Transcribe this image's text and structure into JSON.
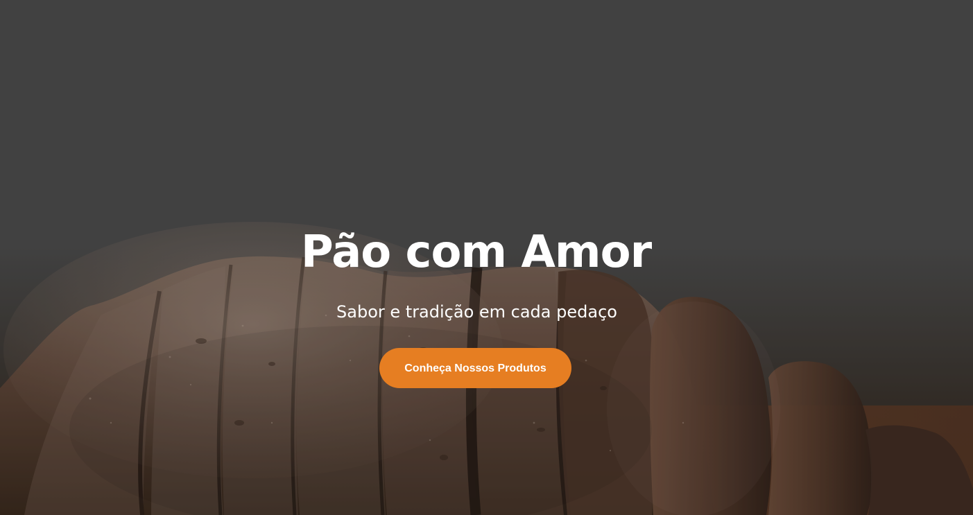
{
  "hero": {
    "title": "Pão com Amor",
    "subtitle": "Sabor e tradição em cada pedaço",
    "cta_label": "Conheça Nossos Produtos",
    "background_image": "sliced-bread-photo"
  },
  "colors": {
    "cta_background": "#e67e22",
    "text": "#ffffff",
    "overlay": "#474747"
  }
}
